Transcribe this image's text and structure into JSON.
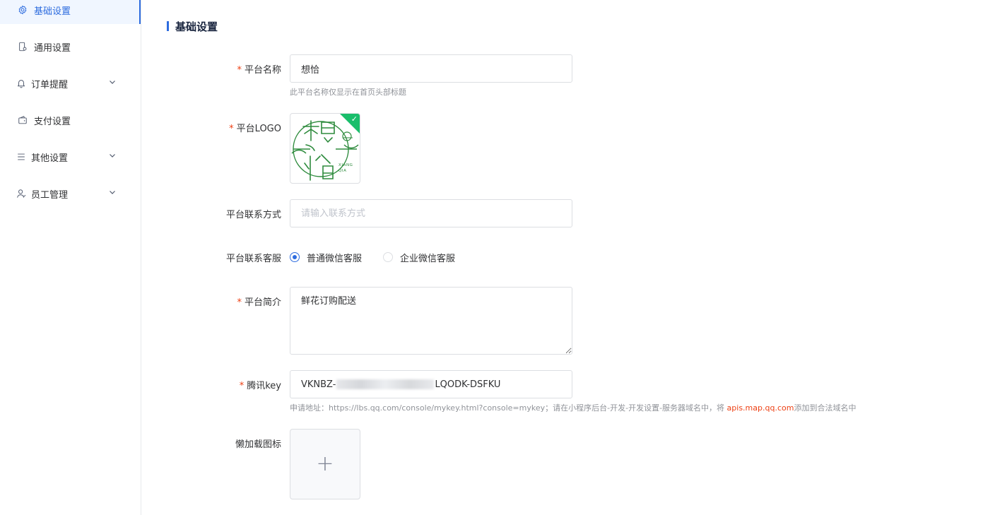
{
  "sidebar": {
    "items": [
      {
        "label": "基础设置",
        "icon": "gear-icon",
        "active": true,
        "has_submenu": false
      },
      {
        "label": "通用设置",
        "icon": "phone-settings-icon",
        "active": false,
        "has_submenu": false
      },
      {
        "label": "订单提醒",
        "icon": "bell-icon",
        "active": false,
        "has_submenu": true
      },
      {
        "label": "支付设置",
        "icon": "wallet-icon",
        "active": false,
        "has_submenu": false
      },
      {
        "label": "其他设置",
        "icon": "list-icon",
        "active": false,
        "has_submenu": true
      },
      {
        "label": "员工管理",
        "icon": "user-icon",
        "active": false,
        "has_submenu": true
      }
    ]
  },
  "section": {
    "title": "基础设置"
  },
  "form": {
    "platform_name": {
      "label": "平台名称",
      "required": true,
      "value": "想恰",
      "hint": "此平台名称仅显示在首页头部标题"
    },
    "platform_logo": {
      "label": "平台LOGO",
      "required": true,
      "logo_text": "XIANG QIA"
    },
    "contact": {
      "label": "平台联系方式",
      "placeholder": "请输入联系方式"
    },
    "customer_service": {
      "label": "平台联系客服",
      "options": [
        "普通微信客服",
        "企业微信客服"
      ],
      "selected": "普通微信客服"
    },
    "intro": {
      "label": "平台简介",
      "required": true,
      "value": "鲜花订购配送"
    },
    "tencent_key": {
      "label": "腾讯key",
      "required": true,
      "value_prefix": "VKNBZ-",
      "value_suffix": "LQODK-DSFKU",
      "hint_prefix": "申请地址：https://lbs.qq.com/console/mykey.html?console=mykey；请在小程序后台-开发-开发设置-服务器域名中，将 ",
      "hint_link": "apis.map.qq.com",
      "hint_suffix": "添加到合法域名中"
    },
    "lazy_icon": {
      "label": "懒加载图标",
      "upload_symbol": "+"
    }
  },
  "colors": {
    "accent": "#2d6cdf",
    "required": "#ed4014",
    "success": "#19be6b",
    "logo_green": "#2e8b3d"
  }
}
